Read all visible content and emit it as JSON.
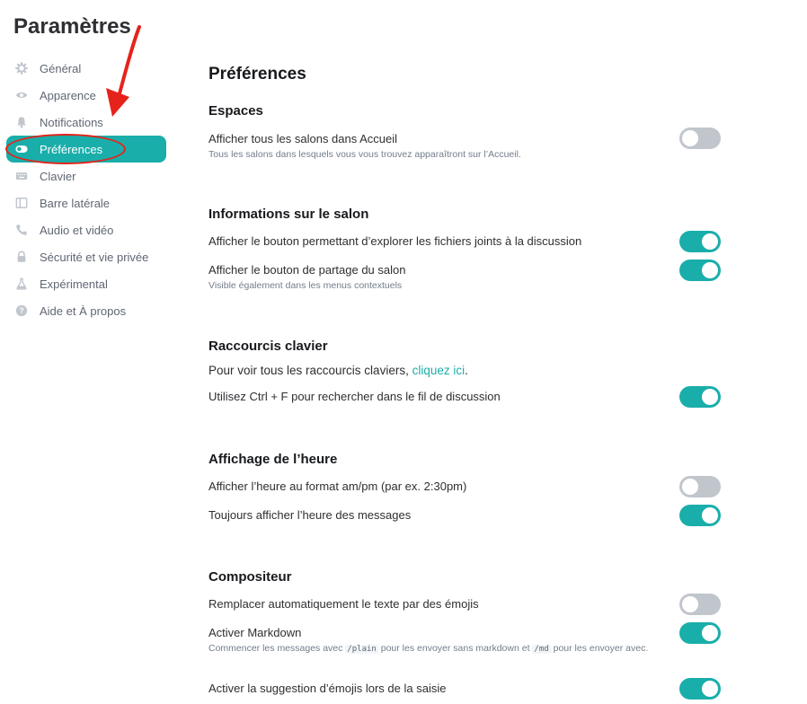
{
  "sidebar": {
    "title": "Paramètres",
    "items": [
      {
        "label": "Général",
        "icon": "gear-icon"
      },
      {
        "label": "Apparence",
        "icon": "eye-icon"
      },
      {
        "label": "Notifications",
        "icon": "bell-icon"
      },
      {
        "label": "Préférences",
        "icon": "toggle-icon",
        "active": true
      },
      {
        "label": "Clavier",
        "icon": "keyboard-icon"
      },
      {
        "label": "Barre latérale",
        "icon": "sidebar-icon"
      },
      {
        "label": "Audio et vidéo",
        "icon": "phone-icon"
      },
      {
        "label": "Sécurité et vie privée",
        "icon": "lock-icon"
      },
      {
        "label": "Expérimental",
        "icon": "flask-icon"
      },
      {
        "label": "Aide et À propos",
        "icon": "help-icon"
      }
    ]
  },
  "annotation": {
    "color": "#e5231b"
  },
  "main": {
    "heading": "Préférences",
    "sections": {
      "espaces": {
        "title": "Espaces",
        "show_all_rooms": {
          "label": "Afficher tous les salons dans Accueil",
          "desc": "Tous les salons dans lesquels vous vous trouvez apparaîtront sur l’Accueil.",
          "on": false
        }
      },
      "room_info": {
        "title": "Informations sur le salon",
        "files_button": {
          "label": "Afficher le bouton permettant d’explorer les fichiers joints à la discussion",
          "on": true
        },
        "share_button": {
          "label": "Afficher le bouton de partage du salon",
          "desc": "Visible également dans les menus contextuels",
          "on": true
        }
      },
      "shortcuts": {
        "title": "Raccourcis clavier",
        "intro_prefix": "Pour voir tous les raccourcis claviers, ",
        "intro_link": "cliquez ici",
        "intro_suffix": ".",
        "ctrl_f": {
          "label": "Utilisez Ctrl + F pour rechercher dans le fil de discussion",
          "on": true
        }
      },
      "time": {
        "title": "Affichage de l’heure",
        "ampm": {
          "label": "Afficher l’heure au format am/pm (par ex. 2:30pm)",
          "on": false
        },
        "always_show": {
          "label": "Toujours afficher l’heure des messages",
          "on": true
        }
      },
      "composer": {
        "title": "Compositeur",
        "auto_emoji": {
          "label": "Remplacer automatiquement le texte par des émojis",
          "on": false
        },
        "markdown": {
          "label": "Activer Markdown",
          "desc_1": "Commencer les messages avec ",
          "code_1": "/plain",
          "desc_2": " pour les envoyer sans markdown et ",
          "code_2": "/md",
          "desc_3": " pour les envoyer avec.",
          "on": true
        },
        "emoji_suggest": {
          "label": "Activer la suggestion d’émojis lors de la saisie",
          "on": true
        }
      }
    }
  }
}
